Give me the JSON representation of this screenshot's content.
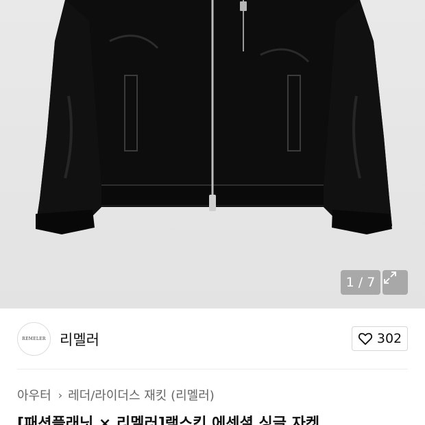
{
  "gallery": {
    "counter": "1 / 7",
    "image_icon": "leather-jacket-image",
    "expand_icon": "expand-icon"
  },
  "brand": {
    "logo_text": "REMELER",
    "name": "리멜러"
  },
  "like": {
    "icon": "heart-icon",
    "count": "302"
  },
  "breadcrumb": {
    "category": "아우터",
    "subcategory": "레더/라이더스 재킷 (리멜러)"
  },
  "product": {
    "title": "[패션플래닛 × 리멜러]램스킨 에센셜 싱글 자켓"
  },
  "colors": {
    "background": "#ffffff",
    "image_bg": "#e6e6e6",
    "text_primary": "#111111",
    "text_secondary": "#666666"
  }
}
